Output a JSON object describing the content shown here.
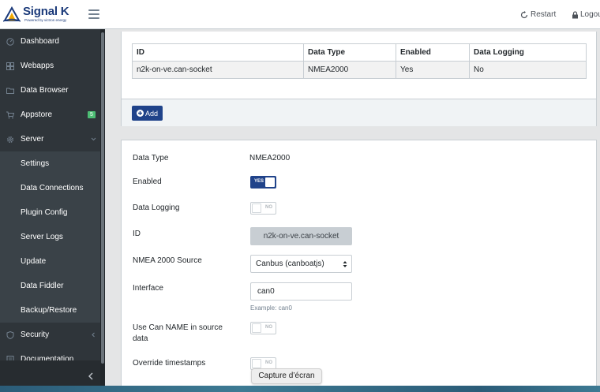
{
  "header": {
    "brand_title": "Signal K",
    "brand_sub": "Powered by victron energy",
    "restart_label": "Restart",
    "logout_label": "Logou"
  },
  "sidebar": {
    "items": [
      {
        "label": "Dashboard",
        "icon": "speedometer-icon"
      },
      {
        "label": "Webapps",
        "icon": "grid-icon"
      },
      {
        "label": "Data Browser",
        "icon": "folder-icon"
      },
      {
        "label": "Appstore",
        "icon": "cart-icon",
        "badge": "5"
      },
      {
        "label": "Server",
        "icon": "settings-icon"
      },
      {
        "label": "Settings"
      },
      {
        "label": "Data Connections"
      },
      {
        "label": "Plugin Config"
      },
      {
        "label": "Server Logs"
      },
      {
        "label": "Update"
      },
      {
        "label": "Data Fiddler"
      },
      {
        "label": "Backup/Restore"
      },
      {
        "label": "Security",
        "icon": "shield-icon"
      },
      {
        "label": "Documentation",
        "icon": "book-icon"
      }
    ]
  },
  "connections_table": {
    "headers": [
      "ID",
      "Data Type",
      "Enabled",
      "Data Logging"
    ],
    "rows": [
      [
        "n2k-on-ve.can-socket",
        "NMEA2000",
        "Yes",
        "No"
      ]
    ],
    "add_label": "Add"
  },
  "form": {
    "data_type_label": "Data Type",
    "data_type_value": "NMEA2000",
    "enabled_label": "Enabled",
    "enabled_toggle": "YES",
    "data_logging_label": "Data Logging",
    "data_logging_toggle": "NO",
    "id_label": "ID",
    "id_value": "n2k-on-ve.can-socket",
    "source_label": "NMEA 2000 Source",
    "source_value": "Canbus (canboatjs)",
    "interface_label": "Interface",
    "interface_value": "can0",
    "interface_help": "Example: can0",
    "can_name_label_1": "Use Can NAME in source",
    "can_name_label_2": "data",
    "can_name_toggle": "NO",
    "override_label": "Override timestamps",
    "override_toggle": "NO"
  },
  "tooltip": "Capture d’écran",
  "colors": {
    "sidebar_bg": "#2f353a",
    "primary": "#20438a",
    "badge": "#4dbd74"
  }
}
